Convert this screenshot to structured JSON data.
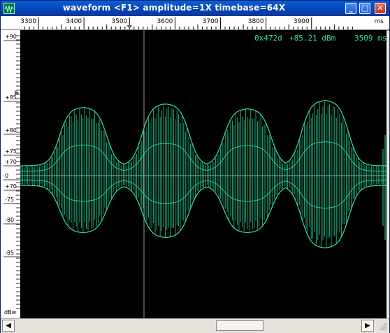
{
  "window": {
    "title": "waveform  <F1> amplitude=1X timebase=64X",
    "buttons": {
      "minimize": "_",
      "maximize": "□",
      "close": "✕"
    }
  },
  "x_ruler": {
    "labels": [
      "3300",
      "3400",
      "3500",
      "3600",
      "3700",
      "3800",
      "3900"
    ],
    "unit": "ms",
    "marker_value": 3500
  },
  "y_ruler": {
    "labels": [
      "+90",
      "+85",
      "+80",
      "+75",
      "+70",
      "0",
      "+70",
      "-75",
      "-80",
      "-85"
    ],
    "unit": "dBw"
  },
  "readout": {
    "sample": "0x472d",
    "level": "+85.21 dBm",
    "time": "3509 ms"
  },
  "colors": {
    "trace": "#2bd69a",
    "readout": "#33dd99",
    "background": "#000000",
    "cursor": "#9a9a9a"
  },
  "icons": {
    "app": "waveform-app-icon",
    "left": "left-arrow-icon",
    "right": "right-arrow-icon"
  }
}
